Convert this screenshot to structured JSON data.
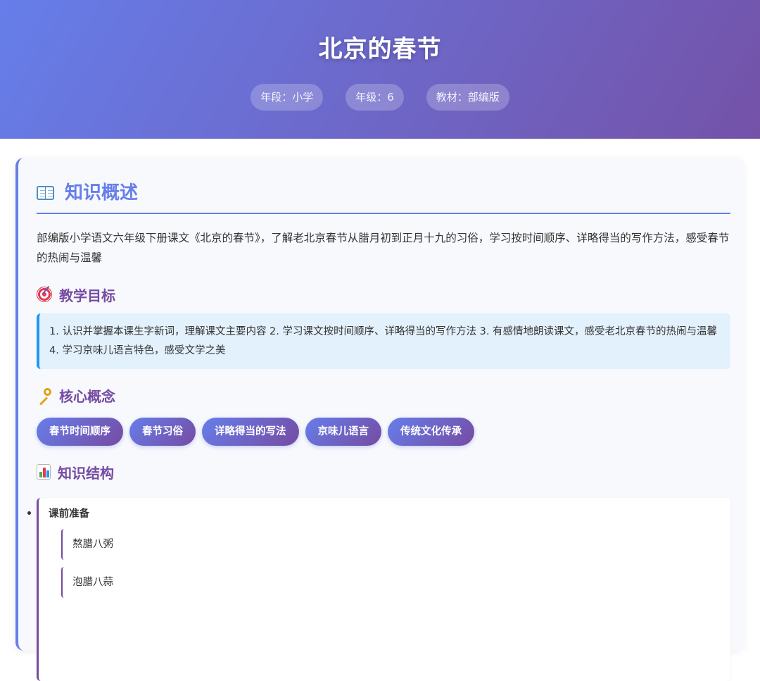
{
  "header": {
    "title": "北京的春节",
    "tags": [
      "年段：小学",
      "年级：6",
      "教材：部编版"
    ]
  },
  "overview": {
    "icon": "open-book-icon",
    "heading": "知识概述",
    "summary": "部编版小学语文六年级下册课文《北京的春节》，了解老北京春节从腊月初到正月十九的习俗，学习按时间顺序、详略得当的写作方法，感受春节的热闹与温馨"
  },
  "objectives": {
    "icon": "target-icon",
    "heading": "教学目标",
    "text": "1. 认识并掌握本课生字新词，理解课文主要内容 2. 学习课文按时间顺序、详略得当的写作方法 3. 有感情地朗读课文，感受老北京春节的热闹与温馨 4. 学习京味儿语言特色，感受文学之美"
  },
  "concepts": {
    "icon": "key-icon",
    "heading": "核心概念",
    "items": [
      "春节时间顺序",
      "春节习俗",
      "详略得当的写法",
      "京味儿语言",
      "传统文化传承"
    ]
  },
  "structure": {
    "icon": "bar-chart-icon",
    "heading": "知识结构",
    "section_title": "课前准备",
    "sub_items": [
      "熬腊八粥",
      "泡腊八蒜"
    ]
  },
  "colors": {
    "primary": "#667eea",
    "secondary": "#764ba2",
    "objective_accent": "#2196f3",
    "objective_bg": "#e3f1fd"
  }
}
